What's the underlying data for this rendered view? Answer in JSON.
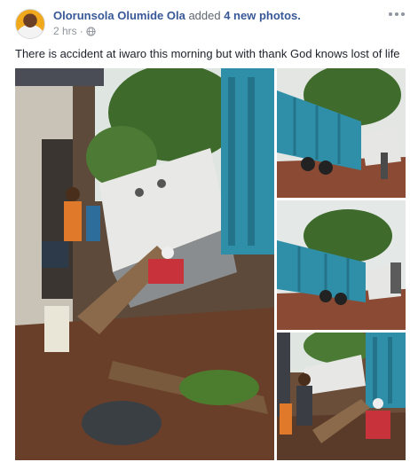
{
  "post": {
    "author": "Olorunsola Olumide Ola",
    "action": "added",
    "photo_count": "4 new photos.",
    "time": "2 hrs",
    "separator": "·",
    "text": "There is accident at iwaro this morning but with thank God knows lost of life"
  },
  "icons": {
    "privacy": "globe-icon",
    "menu": "more-options-icon"
  },
  "colors": {
    "author_link": "#385898",
    "meta_text": "#90949c",
    "body_text": "#1d2129"
  }
}
